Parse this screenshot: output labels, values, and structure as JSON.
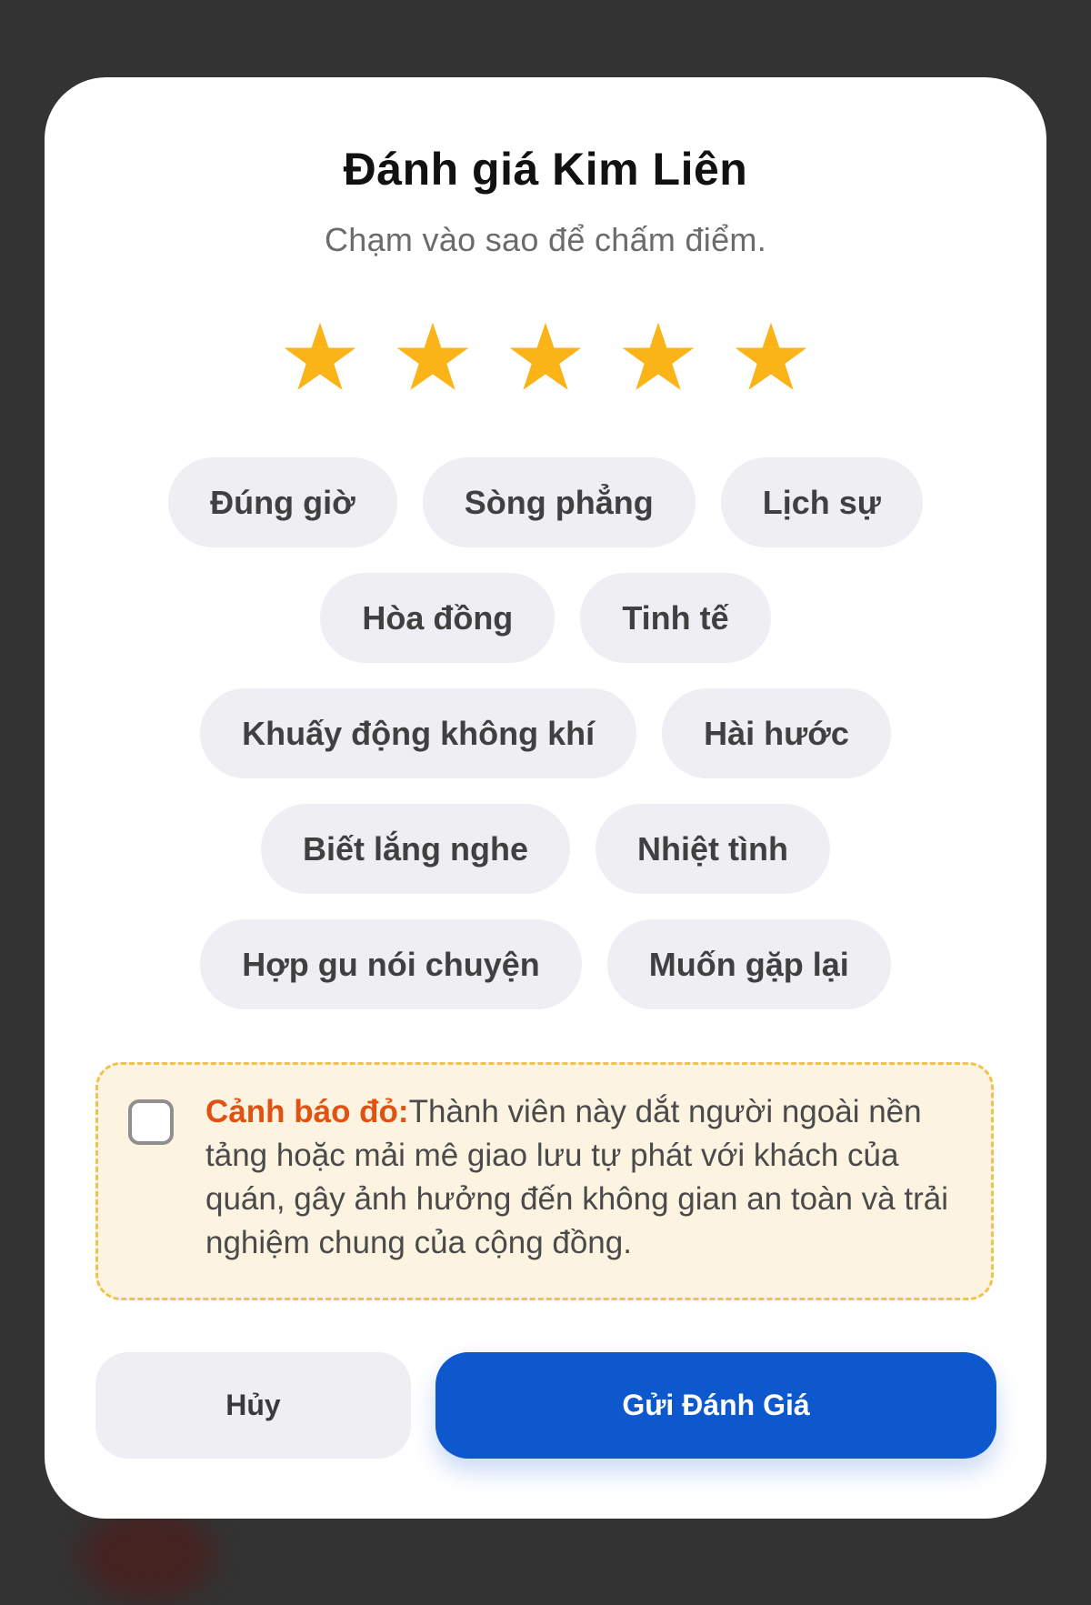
{
  "dialog": {
    "title": "Đánh giá Kim Liên",
    "subtitle": "Chạm vào sao để chấm điểm."
  },
  "rating": {
    "value": 5,
    "max": 5,
    "star_color": "#fbb417"
  },
  "tags": [
    {
      "label": "Đúng giờ"
    },
    {
      "label": "Sòng phẳng"
    },
    {
      "label": "Lịch sự"
    },
    {
      "label": "Hòa đồng"
    },
    {
      "label": "Tinh tế"
    },
    {
      "label": "Khuấy động không khí"
    },
    {
      "label": "Hài hước"
    },
    {
      "label": "Biết lắng nghe"
    },
    {
      "label": "Nhiệt tình"
    },
    {
      "label": "Hợp gu nói chuyện"
    },
    {
      "label": "Muốn gặp lại"
    }
  ],
  "warning": {
    "checked": false,
    "label": "Cảnh báo đỏ:",
    "text": "Thành viên này dắt người ngoài nền tảng hoặc mải mê giao lưu tự phát với khách của quán, gây ảnh hưởng đến không gian an toàn và trải nghiệm chung của cộng đồng."
  },
  "buttons": {
    "cancel_label": "Hủy",
    "submit_label": "Gửi Đánh Giá"
  },
  "colors": {
    "overlay": "#333333",
    "primary": "#0d58cc",
    "warning_label": "#e05212",
    "warning_bg": "#fdf3e1",
    "warning_border": "#f2c24f",
    "chip_bg": "#efeff3"
  }
}
